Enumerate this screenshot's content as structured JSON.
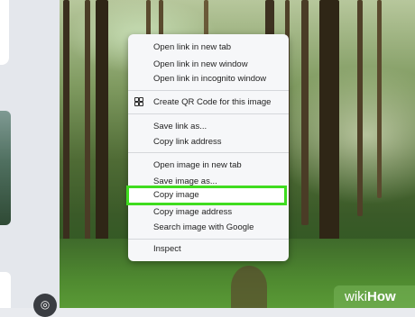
{
  "context_menu": {
    "items": [
      {
        "label": "Open link in new tab"
      },
      {
        "label": "Open link in new window"
      },
      {
        "label": "Open link in incognito window"
      },
      {
        "label": "Create QR Code for this image",
        "icon": "qr-code-icon"
      },
      {
        "label": "Save link as..."
      },
      {
        "label": "Copy link address"
      },
      {
        "label": "Open image in new tab"
      },
      {
        "label": "Save image as..."
      },
      {
        "label": "Copy image",
        "highlighted": true
      },
      {
        "label": "Copy image address"
      },
      {
        "label": "Search image with Google"
      },
      {
        "label": "Inspect"
      }
    ]
  },
  "highlight_color": "#3fdc1f",
  "watermark": {
    "part1": "wiki",
    "part2": "How"
  },
  "lens_button": {
    "icon": "lens-icon"
  }
}
